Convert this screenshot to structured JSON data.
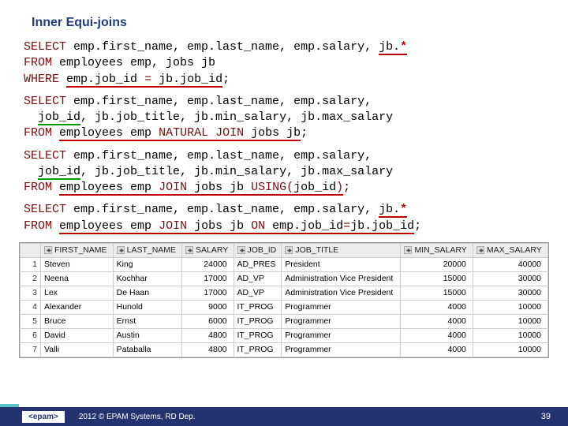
{
  "title": "Inner Equi-joins",
  "sql": {
    "q1": {
      "l1a": "SELECT",
      "l1b": " emp.first_name, emp.last_name, emp.salary, ",
      "l1c": "jb.",
      "l1d": "*",
      "l2a": "FROM",
      "l2b": " employees emp, jobs jb",
      "l3a": "WHERE",
      "l3b": " ",
      "l3c": "emp.job_id ",
      "l3d": "=",
      "l3e": " jb.job_id",
      "l3f": ";"
    },
    "q2": {
      "l1a": "SELECT",
      "l1b": " emp.first_name, emp.last_name, emp.salary,",
      "l2a": "  ",
      "l2b": "job_id",
      "l2c": ", jb.job_title, jb.min_salary, jb.max_salary",
      "l3a": "FROM",
      "l3b": " ",
      "l3c": "employees emp ",
      "l3d": "NATURAL JOIN",
      "l3e": " jobs jb",
      "l3f": ";"
    },
    "q3": {
      "l1a": "SELECT",
      "l1b": " emp.first_name, emp.last_name, emp.salary,",
      "l2a": "  ",
      "l2b": "job_id",
      "l2c": ", jb.job_title, jb.min_salary, jb.max_salary",
      "l3a": "FROM",
      "l3b": " ",
      "l3c": "employees emp ",
      "l3d": "JOIN",
      "l3e": " jobs jb ",
      "l3f": "USING(",
      "l3g": "job_id",
      "l3h": ")",
      "l3i": ";"
    },
    "q4": {
      "l1a": "SELECT",
      "l1b": " emp.first_name, emp.last_name, emp.salary, ",
      "l1c": "jb.",
      "l1d": "*",
      "l2a": "FROM",
      "l2b": " ",
      "l2c": "employees emp ",
      "l2d": "JOIN",
      "l2e": " jobs jb ",
      "l2f": "ON",
      "l2g": " emp.job_id",
      "l2h": "=",
      "l2i": "jb.job_id",
      "l2j": ";"
    }
  },
  "table": {
    "headers": [
      "",
      "FIRST_NAME",
      "LAST_NAME",
      "SALARY",
      "JOB_ID",
      "JOB_TITLE",
      "MIN_SALARY",
      "MAX_SALARY"
    ],
    "rows": [
      {
        "n": "1",
        "fn": "Steven",
        "ln": "King",
        "sal": "24000",
        "jid": "AD_PRES",
        "jt": "President",
        "min": "20000",
        "max": "40000"
      },
      {
        "n": "2",
        "fn": "Neena",
        "ln": "Kochhar",
        "sal": "17000",
        "jid": "AD_VP",
        "jt": "Administration Vice President",
        "min": "15000",
        "max": "30000"
      },
      {
        "n": "3",
        "fn": "Lex",
        "ln": "De Haan",
        "sal": "17000",
        "jid": "AD_VP",
        "jt": "Administration Vice President",
        "min": "15000",
        "max": "30000"
      },
      {
        "n": "4",
        "fn": "Alexander",
        "ln": "Hunold",
        "sal": "9000",
        "jid": "IT_PROG",
        "jt": "Programmer",
        "min": "4000",
        "max": "10000"
      },
      {
        "n": "5",
        "fn": "Bruce",
        "ln": "Ernst",
        "sal": "6000",
        "jid": "IT_PROG",
        "jt": "Programmer",
        "min": "4000",
        "max": "10000"
      },
      {
        "n": "6",
        "fn": "David",
        "ln": "Austin",
        "sal": "4800",
        "jid": "IT_PROG",
        "jt": "Programmer",
        "min": "4000",
        "max": "10000"
      },
      {
        "n": "7",
        "fn": "Valli",
        "ln": "Pataballa",
        "sal": "4800",
        "jid": "IT_PROG",
        "jt": "Programmer",
        "min": "4000",
        "max": "10000"
      }
    ]
  },
  "footer": {
    "logo": "<epam>",
    "text": "2012 © EPAM Systems, RD Dep.",
    "page": "39"
  }
}
